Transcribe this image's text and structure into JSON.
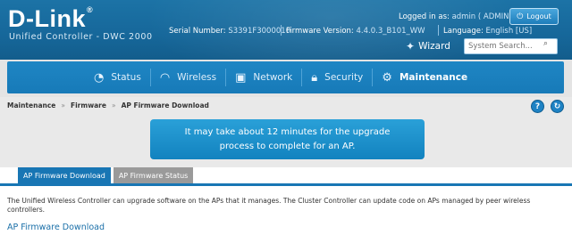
{
  "brand": {
    "logo": "D-Link",
    "logo_mark": "®",
    "product": "Unified Controller - DWC 2000"
  },
  "header": {
    "logged_in_label": "Logged in as:",
    "logged_in_user": "admin ( ADMIN )",
    "logout_label": "Logout",
    "serial_label": "Serial Number:",
    "serial_value": "S3391F3000010",
    "firmware_label": "Firmware Version:",
    "firmware_value": "4.4.0.3_B101_WW",
    "language_label": "Language:",
    "language_value": "English [US]",
    "wizard_label": "Wizard",
    "search_placeholder": "System Search..."
  },
  "nav": {
    "tabs": [
      {
        "label": "Status",
        "icon": "speedometer-icon"
      },
      {
        "label": "Wireless",
        "icon": "wifi-icon"
      },
      {
        "label": "Network",
        "icon": "monitor-icon"
      },
      {
        "label": "Security",
        "icon": "lock-icon"
      },
      {
        "label": "Maintenance",
        "icon": "gears-icon",
        "active": true
      }
    ]
  },
  "breadcrumb": {
    "items": [
      "Maintenance",
      "Firmware",
      "AP Firmware Download"
    ],
    "separator": "»"
  },
  "notice": {
    "text": "It may take about 12 minutes for the upgrade process to complete for an AP."
  },
  "page_tabs": [
    {
      "label": "AP Firmware Download",
      "active": true
    },
    {
      "label": "AP Firmware Status",
      "active": false
    }
  ],
  "description": "The Unified Wireless Controller can upgrade software on the APs that it manages. The Cluster Controller can update code on APs managed by peer wireless controllers.",
  "section_title": "AP Firmware Download",
  "colors": {
    "header_blue": "#16679a",
    "nav_blue": "#1f86c4",
    "accent": "#1876b4",
    "notice": "#1a8fcb"
  }
}
